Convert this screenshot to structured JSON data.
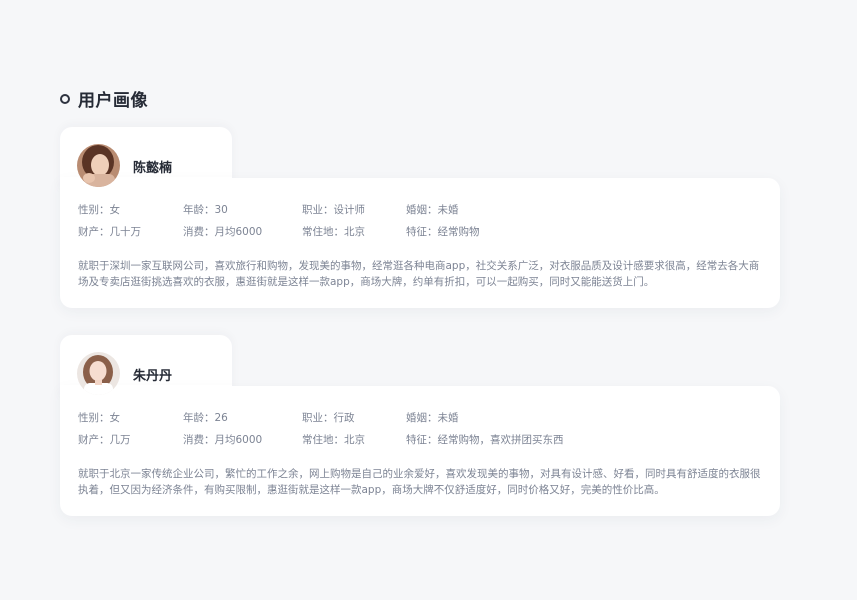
{
  "section": {
    "title": "用户画像"
  },
  "personas": [
    {
      "name": "陈懿楠",
      "gender_label": "性别：",
      "gender": "女",
      "age_label": "年龄：",
      "age": "30",
      "job_label": "职业：",
      "job": "设计师",
      "marriage_label": "婚姻：",
      "marriage": "未婚",
      "assets_label": "财产：",
      "assets": "几十万",
      "spend_label": "消费：",
      "spend": "月均6000",
      "residence_label": "常住地：",
      "residence": "北京",
      "trait_label": "特征：",
      "trait": "经常购物",
      "description": "就职于深圳一家互联网公司，喜欢旅行和购物，发现美的事物，经常逛各种电商app，社交关系广泛，对衣服品质及设计感要求很高，经常去各大商场及专卖店逛街挑选喜欢的衣服，惠逛街就是这样一款app，商场大牌，约单有折扣，可以一起购买，同时又能能送货上门。"
    },
    {
      "name": "朱丹丹",
      "gender_label": "性别：",
      "gender": "女",
      "age_label": "年龄：",
      "age": "26",
      "job_label": "职业：",
      "job": "行政",
      "marriage_label": "婚姻：",
      "marriage": "未婚",
      "assets_label": "财产：",
      "assets": "几万",
      "spend_label": "消费：",
      "spend": "月均6000",
      "residence_label": "常住地：",
      "residence": "北京",
      "trait_label": "特征：",
      "trait": "经常购物，喜欢拼团买东西",
      "description": "就职于北京一家传统企业公司，繁忙的工作之余，网上购物是自己的业余爱好，喜欢发现美的事物，对具有设计感、好看，同时具有舒适度的衣服很执着，但又因为经济条件，有购买限制，惠逛街就是这样一款app，商场大牌不仅舒适度好，同时价格又好，完美的性价比高。"
    }
  ]
}
